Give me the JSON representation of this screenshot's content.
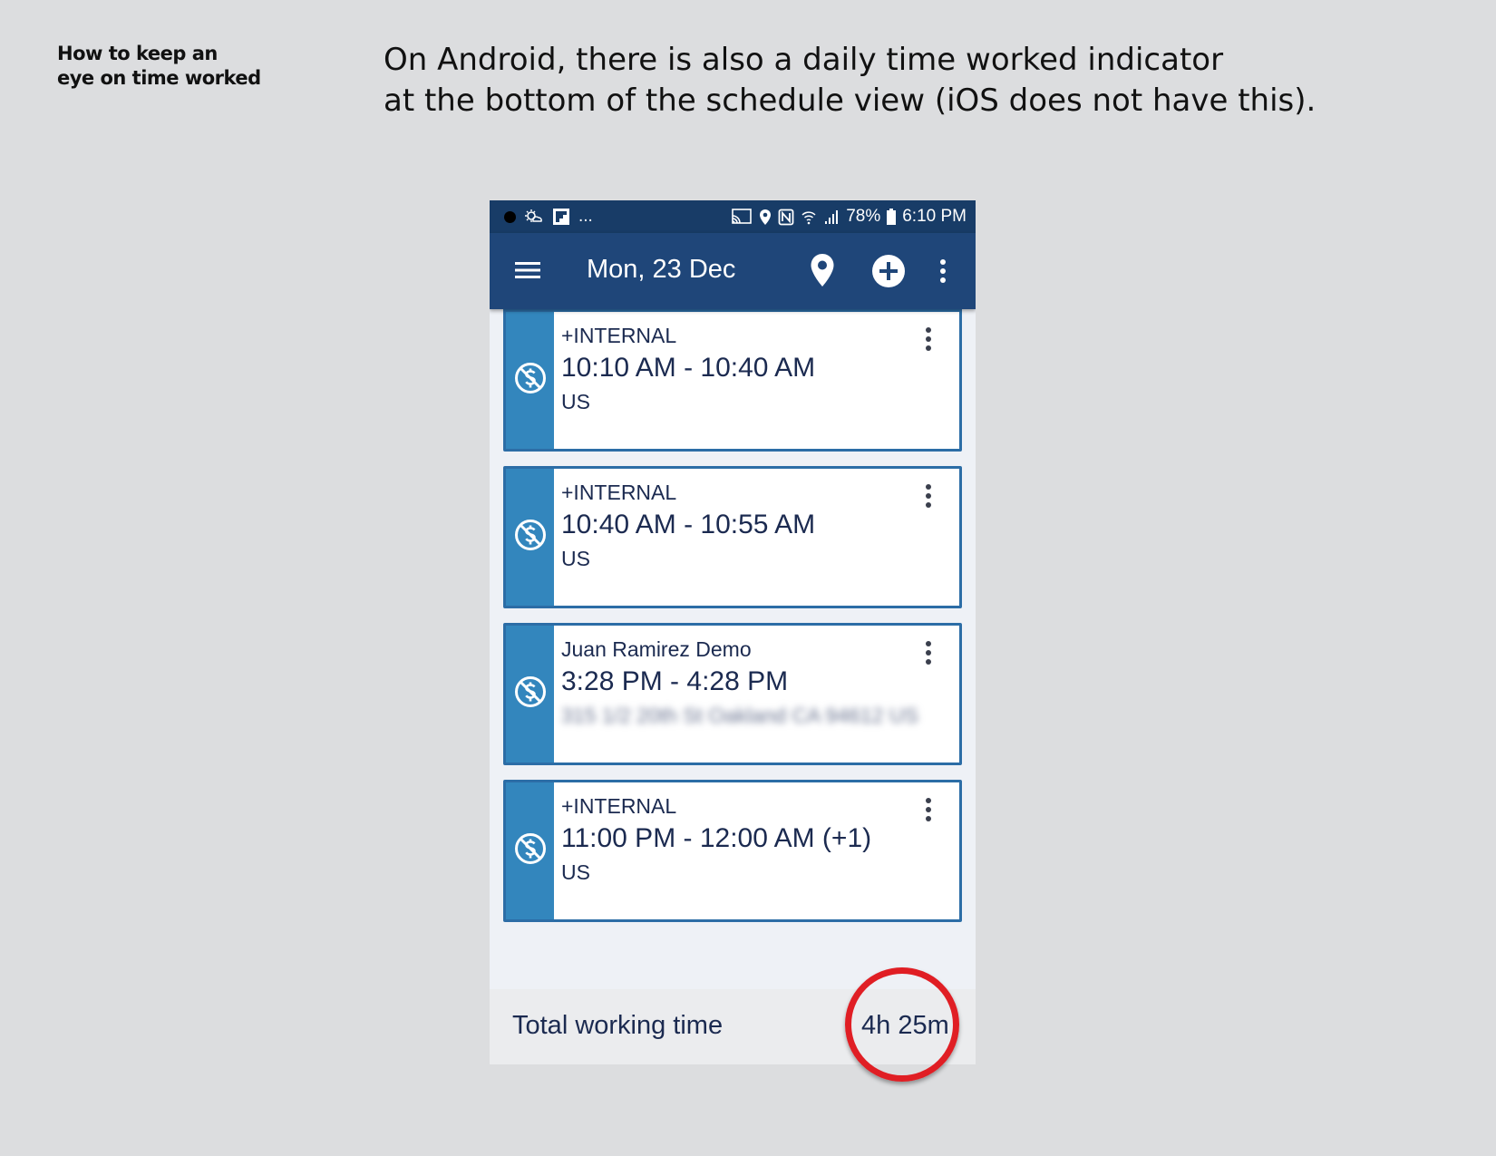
{
  "caption": {
    "side": [
      "How to keep an",
      "eye on time worked"
    ],
    "headline": [
      "On Android, there is also a daily time worked indicator",
      "at the bottom of the schedule view (iOS does not have this)."
    ]
  },
  "status_bar": {
    "left_extra": "...",
    "battery": "78%",
    "clock": "6:10 PM"
  },
  "app_bar": {
    "title": "Mon, 23 Dec",
    "icons": [
      "menu-icon",
      "location-pin-icon",
      "add-circle-icon",
      "more-vert-icon"
    ]
  },
  "appointments": [
    {
      "client": "+INTERNAL",
      "time": "10:10 AM - 10:40 AM",
      "location": "US"
    },
    {
      "client": "+INTERNAL",
      "time": "10:40 AM - 10:55 AM",
      "location": "US"
    },
    {
      "client": "Juan Ramirez Demo",
      "time": "3:28 PM - 4:28 PM",
      "location": "315 1/2 20th St Oakland CA 94612 US"
    },
    {
      "client": "+INTERNAL",
      "time": "11:00 PM - 12:00 AM (+1)",
      "location": "US"
    }
  ],
  "footer": {
    "label": "Total working time",
    "value": "4h 25m"
  },
  "colors": {
    "status_bar": "#183c67",
    "app_bar": "#1f4679",
    "card_stripe": "#3386bd",
    "card_border": "#2c6da6",
    "highlight": "#e01e24"
  }
}
